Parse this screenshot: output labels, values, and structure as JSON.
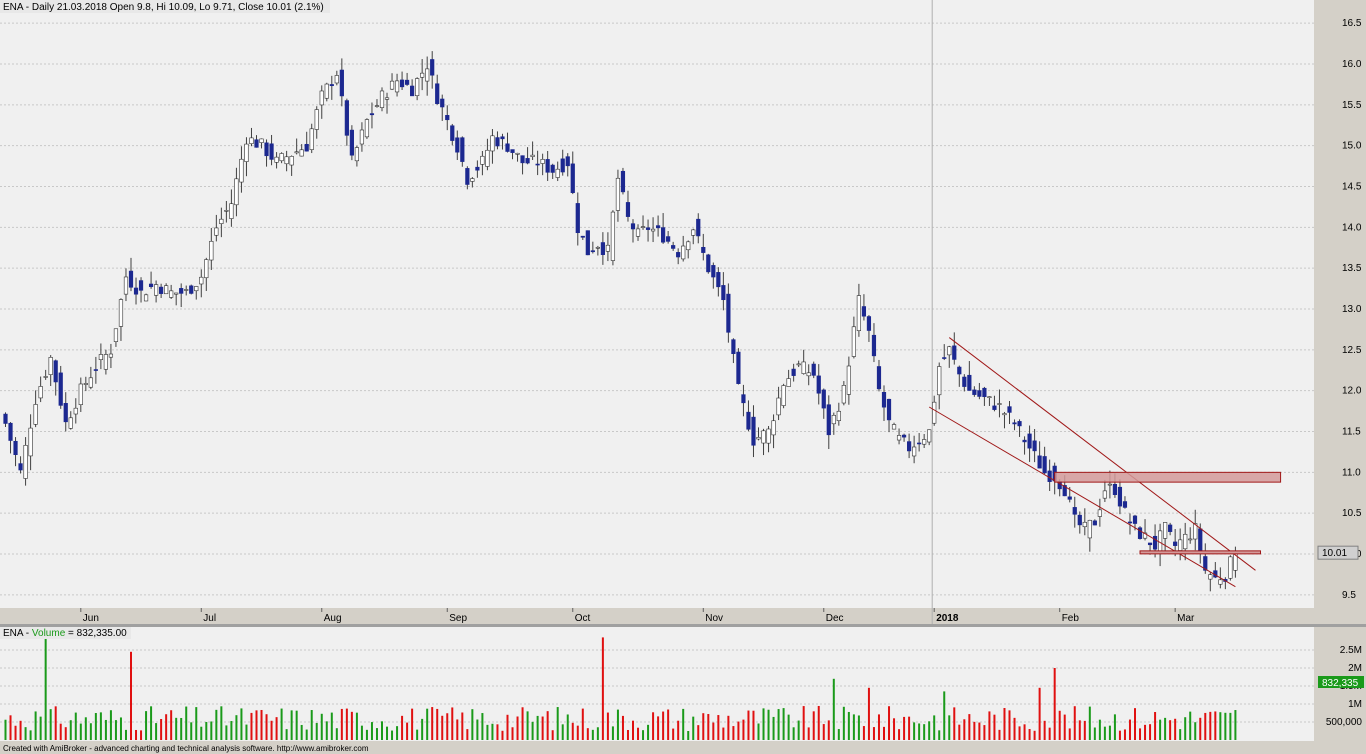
{
  "price_header": "ENA - Daily 21.03.2018 Open 9.8, Hi 10.09, Lo 9.71, Close 10.01 (2.1%)",
  "volume_header": {
    "prefix": "ENA - ",
    "name": "Volume",
    "suffix": " = 832,335.00"
  },
  "footer": "Created with AmiBroker - advanced charting and technical analysis software. http://www.amibroker.com",
  "last_price_label": "10.01",
  "last_volume_label": "832,335",
  "colors": {
    "panel_bg": "#f0f0f0",
    "frame_bg": "#d4d0c8",
    "grid": "#c8c8c8",
    "bull_body": "#ffffff",
    "bear_body": "#1c2890",
    "wick": "#404040",
    "vol_up": "#1a9a1a",
    "vol_down": "#e01010",
    "channel": "#a01818",
    "zone_fill": "#d49a9a",
    "zone_border": "#a01818",
    "volume_name": "#1a9a1a"
  },
  "chart_data": [
    {
      "type": "candlestick",
      "ylim": [
        9.4,
        16.6
      ],
      "y_ticks": [
        9.5,
        10.0,
        10.5,
        11.0,
        11.5,
        12.0,
        12.5,
        13.0,
        13.5,
        14.0,
        14.5,
        15.0,
        15.5,
        16.0,
        16.5
      ],
      "y_tick_labels": [
        "9.5",
        "10.0",
        "10.5",
        "11.0",
        "11.5",
        "12.0",
        "12.5",
        "13.0",
        "13.5",
        "14.0",
        "14.5",
        "15.0",
        "15.5",
        "16.0",
        "16.5"
      ],
      "month_labels": [
        {
          "label": "Jun",
          "bar": 15
        },
        {
          "label": "Jul",
          "bar": 39
        },
        {
          "label": "Aug",
          "bar": 63
        },
        {
          "label": "Sep",
          "bar": 88
        },
        {
          "label": "Oct",
          "bar": 113
        },
        {
          "label": "Nov",
          "bar": 139
        },
        {
          "label": "Dec",
          "bar": 163
        },
        {
          "label": "2018",
          "bar": 185
        },
        {
          "label": "Feb",
          "bar": 210
        },
        {
          "label": "Mar",
          "bar": 233
        }
      ],
      "year_divider_bar": 185,
      "close_path": [
        [
          0,
          11.6
        ],
        [
          3,
          11.0
        ],
        [
          6,
          11.9
        ],
        [
          9,
          12.4
        ],
        [
          12,
          11.6
        ],
        [
          15,
          12.0
        ],
        [
          18,
          12.3
        ],
        [
          21,
          12.5
        ],
        [
          24,
          13.4
        ],
        [
          27,
          13.2
        ],
        [
          30,
          13.3
        ],
        [
          33,
          13.2
        ],
        [
          36,
          13.2
        ],
        [
          39,
          13.4
        ],
        [
          42,
          14.0
        ],
        [
          45,
          14.3
        ],
        [
          48,
          15.1
        ],
        [
          51,
          15.0
        ],
        [
          54,
          14.8
        ],
        [
          57,
          14.9
        ],
        [
          60,
          15.0
        ],
        [
          63,
          15.6
        ],
        [
          66,
          15.9
        ],
        [
          69,
          14.8
        ],
        [
          72,
          15.3
        ],
        [
          75,
          15.6
        ],
        [
          78,
          15.8
        ],
        [
          81,
          15.7
        ],
        [
          84,
          16.0
        ],
        [
          86,
          15.6
        ],
        [
          88,
          15.3
        ],
        [
          90,
          15.0
        ],
        [
          92,
          14.6
        ],
        [
          95,
          14.8
        ],
        [
          97,
          15.1
        ],
        [
          100,
          15.0
        ],
        [
          103,
          14.8
        ],
        [
          106,
          14.8
        ],
        [
          109,
          14.7
        ],
        [
          112,
          14.8
        ],
        [
          114,
          14.0
        ],
        [
          116,
          13.7
        ],
        [
          118,
          13.8
        ],
        [
          120,
          13.7
        ],
        [
          122,
          14.6
        ],
        [
          124,
          14.1
        ],
        [
          126,
          13.9
        ],
        [
          128,
          14.0
        ],
        [
          131,
          13.9
        ],
        [
          134,
          13.7
        ],
        [
          137,
          14.0
        ],
        [
          140,
          13.5
        ],
        [
          143,
          13.1
        ],
        [
          146,
          12.0
        ],
        [
          149,
          11.4
        ],
        [
          152,
          11.5
        ],
        [
          155,
          12.1
        ],
        [
          158,
          12.3
        ],
        [
          161,
          12.2
        ],
        [
          164,
          11.5
        ],
        [
          167,
          12.0
        ],
        [
          170,
          13.1
        ],
        [
          172,
          12.7
        ],
        [
          174,
          12.0
        ],
        [
          176,
          11.6
        ],
        [
          178,
          11.4
        ],
        [
          180,
          11.3
        ],
        [
          182,
          11.4
        ],
        [
          184,
          11.5
        ],
        [
          186,
          12.3
        ],
        [
          188,
          12.5
        ],
        [
          190,
          12.2
        ],
        [
          192,
          12.0
        ],
        [
          195,
          11.9
        ],
        [
          198,
          11.8
        ],
        [
          201,
          11.6
        ],
        [
          204,
          11.3
        ],
        [
          207,
          11.0
        ],
        [
          209,
          10.95
        ],
        [
          211,
          10.8
        ],
        [
          213,
          10.4
        ],
        [
          215,
          10.3
        ],
        [
          217,
          10.4
        ],
        [
          219,
          10.8
        ],
        [
          221,
          10.8
        ],
        [
          223,
          10.5
        ],
        [
          225,
          10.3
        ],
        [
          227,
          10.2
        ],
        [
          229,
          10.1
        ],
        [
          231,
          10.3
        ],
        [
          233,
          10.1
        ],
        [
          235,
          10.2
        ],
        [
          237,
          10.3
        ],
        [
          239,
          9.8
        ],
        [
          241,
          9.7
        ],
        [
          243,
          9.75
        ],
        [
          245,
          10.01
        ]
      ],
      "trend_lines": [
        {
          "from": [
            188,
            12.65
          ],
          "to": [
            249,
            9.8
          ]
        },
        {
          "from": [
            184,
            11.8
          ],
          "to": [
            245,
            9.6
          ]
        }
      ],
      "resistance_zone": {
        "from_bar": 209,
        "to_bar": 254,
        "y_low": 10.88,
        "y_high": 11.0
      },
      "support_line": {
        "from_bar": 226,
        "to_bar": 250,
        "y": 10.02
      }
    },
    {
      "type": "bar",
      "series_name": "Volume",
      "ylim": [
        0,
        3000000
      ],
      "y_ticks": [
        500000,
        1000000,
        1500000,
        2000000,
        2500000
      ],
      "y_tick_labels": [
        "500,000",
        "1M",
        "1.5M",
        "2M",
        "2.5M"
      ],
      "last_value": 832335,
      "peaks": [
        {
          "bar": 8,
          "value": 2900000
        },
        {
          "bar": 25,
          "value": 2450000
        },
        {
          "bar": 119,
          "value": 2850000
        },
        {
          "bar": 165,
          "value": 1700000
        },
        {
          "bar": 172,
          "value": 1450000
        },
        {
          "bar": 187,
          "value": 1350000
        },
        {
          "bar": 206,
          "value": 1450000
        },
        {
          "bar": 209,
          "value": 2000000
        }
      ]
    }
  ]
}
